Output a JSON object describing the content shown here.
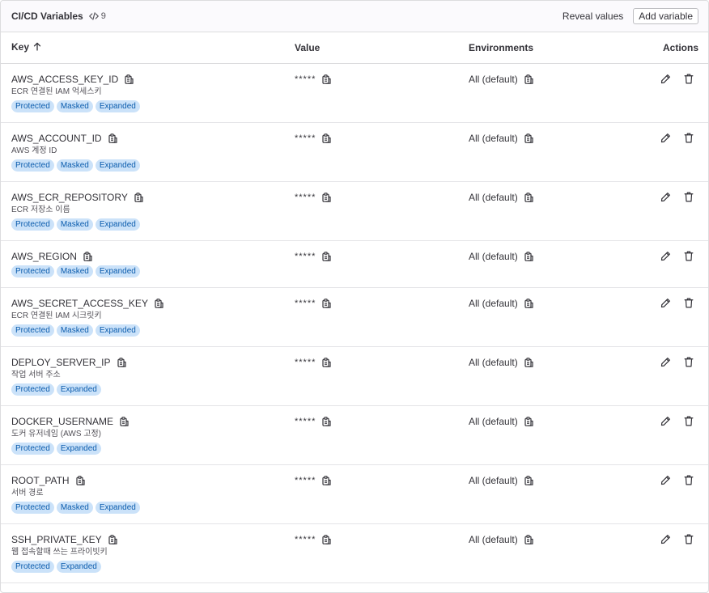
{
  "header": {
    "title": "CI/CD Variables",
    "count": "9",
    "reveal_label": "Reveal values",
    "add_label": "Add variable"
  },
  "columns": {
    "key": "Key",
    "value": "Value",
    "environments": "Environments",
    "actions": "Actions"
  },
  "rows": [
    {
      "key": "AWS_ACCESS_KEY_ID",
      "desc": "ECR 연결된 IAM 억세스키",
      "value": "*****",
      "env": "All (default)",
      "badges": [
        "Protected",
        "Masked",
        "Expanded"
      ]
    },
    {
      "key": "AWS_ACCOUNT_ID",
      "desc": "AWS 계정 ID",
      "value": "*****",
      "env": "All (default)",
      "badges": [
        "Protected",
        "Masked",
        "Expanded"
      ]
    },
    {
      "key": "AWS_ECR_REPOSITORY",
      "desc": "ECR 저장소 이름",
      "value": "*****",
      "env": "All (default)",
      "badges": [
        "Protected",
        "Masked",
        "Expanded"
      ]
    },
    {
      "key": "AWS_REGION",
      "desc": "",
      "value": "*****",
      "env": "All (default)",
      "badges": [
        "Protected",
        "Masked",
        "Expanded"
      ]
    },
    {
      "key": "AWS_SECRET_ACCESS_KEY",
      "desc": "ECR 연결된 IAM 시크릿키",
      "value": "*****",
      "env": "All (default)",
      "badges": [
        "Protected",
        "Masked",
        "Expanded"
      ]
    },
    {
      "key": "DEPLOY_SERVER_IP",
      "desc": "작업 서버 주소",
      "value": "*****",
      "env": "All (default)",
      "badges": [
        "Protected",
        "Expanded"
      ]
    },
    {
      "key": "DOCKER_USERNAME",
      "desc": "도커 유저네임 (AWS 고정)",
      "value": "*****",
      "env": "All (default)",
      "badges": [
        "Protected",
        "Expanded"
      ]
    },
    {
      "key": "ROOT_PATH",
      "desc": "서버 경로",
      "value": "*****",
      "env": "All (default)",
      "badges": [
        "Protected",
        "Masked",
        "Expanded"
      ]
    },
    {
      "key": "SSH_PRIVATE_KEY",
      "desc": "웹 접속할때 쓰는 프라이빗키",
      "value": "*****",
      "env": "All (default)",
      "badges": [
        "Protected",
        "Expanded"
      ]
    }
  ]
}
